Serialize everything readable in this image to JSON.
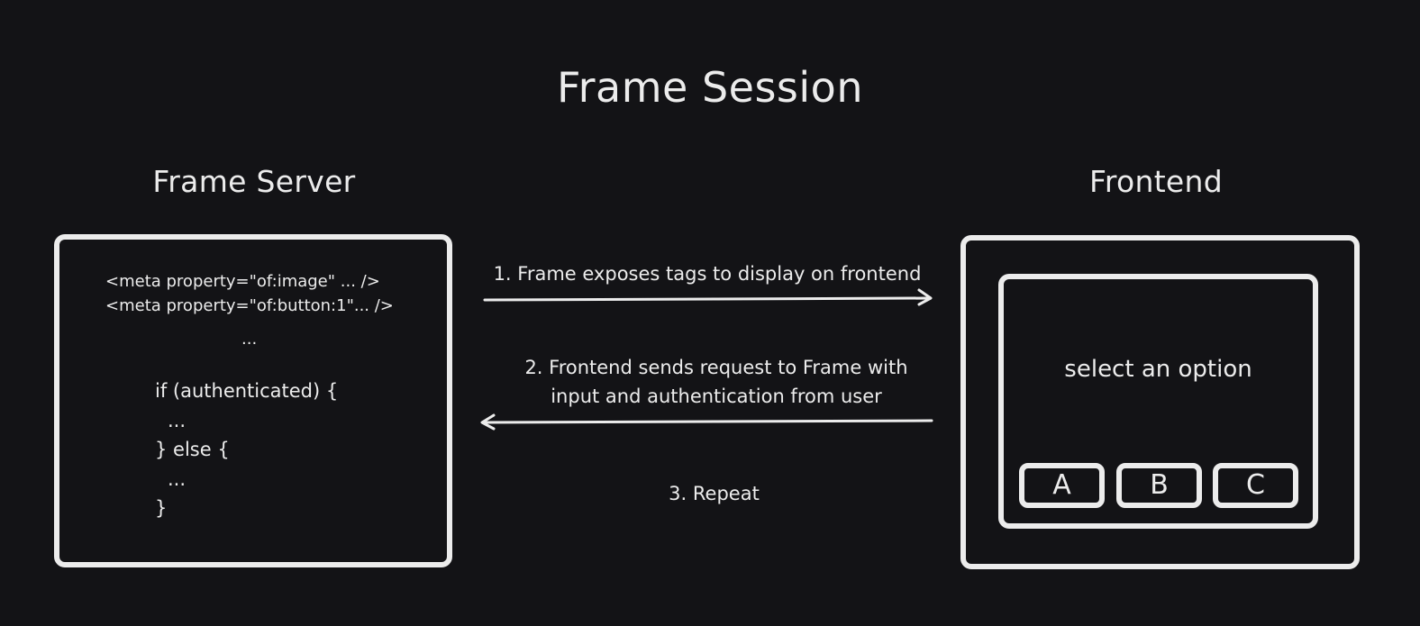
{
  "title": "Frame Session",
  "server": {
    "heading": "Frame Server",
    "code_lines": [
      "<meta property=\"of:image\" ... />",
      "<meta property=\"of:button:1\"... />",
      "...",
      "if (authenticated) {",
      "...",
      "} else {",
      "...",
      "}"
    ]
  },
  "frontend": {
    "heading": "Frontend",
    "prompt": "select an option",
    "buttons": [
      "A",
      "B",
      "C"
    ]
  },
  "steps": {
    "step1": "1. Frame exposes tags to display on frontend",
    "step2_line1": "2. Frontend sends request to Frame with",
    "step2_line2": "input and authentication from user",
    "step3": "3. Repeat"
  },
  "colors": {
    "background": "#131316",
    "foreground": "#ececec"
  }
}
